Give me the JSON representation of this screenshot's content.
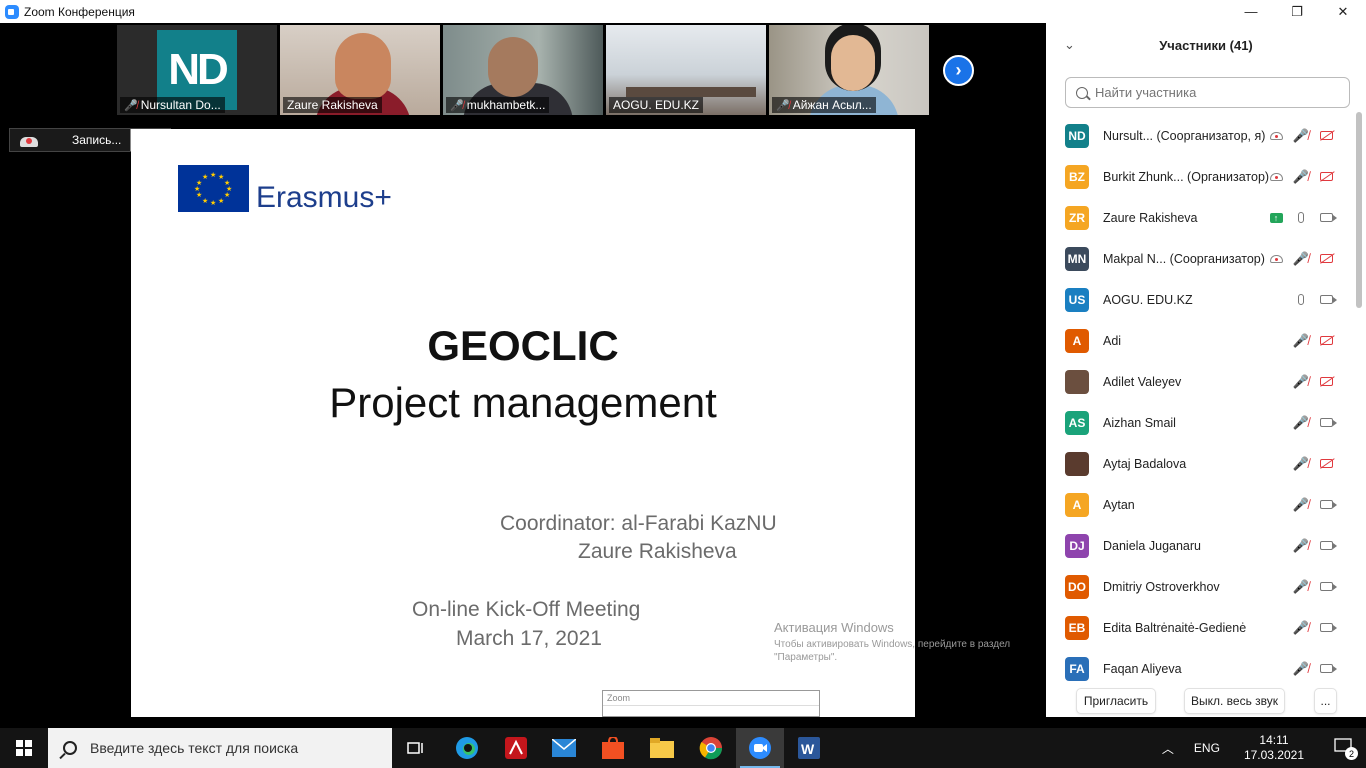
{
  "window": {
    "title": "Zoom Конференция",
    "minimize": "—",
    "maximize": "❐",
    "close": "✕"
  },
  "thumbnails": [
    {
      "name": "Nursultan Do...",
      "muted": true
    },
    {
      "name": "Zaure Rakisheva",
      "muted": false,
      "active": true
    },
    {
      "name": "mukhambetk...",
      "muted": true
    },
    {
      "name": "AOGU. EDU.KZ",
      "muted": false
    },
    {
      "name": "Айжан Асыл...",
      "muted": true
    }
  ],
  "thumb_logo": "ND",
  "recording": {
    "label": "Запись..."
  },
  "slide": {
    "brand": "Erasmus+",
    "title": "GEOCLIC",
    "subtitle": "Project management",
    "coordinator_line1": "Coordinator: al-Farabi KazNU",
    "coordinator_line2": "Zaure Rakisheva",
    "meeting_line1": "On-line Kick-Off Meeting",
    "meeting_line2": "March 17, 2021"
  },
  "activation": {
    "line1": "Активация Windows",
    "line2": "Чтобы активировать Windows, перейдите в раздел",
    "line3": "\"Параметры\"."
  },
  "zoom_popup": {
    "title": "Zoom"
  },
  "panel": {
    "collapse_icon": "⌄",
    "title": "Участники (41)",
    "search_placeholder": "Найти участника",
    "participants": [
      {
        "initials": "ND",
        "color": "#12808a",
        "name": "Nursult...  (Соорганизатор, я)",
        "rec": true,
        "mic": "off",
        "cam": "off"
      },
      {
        "initials": "BZ",
        "color": "#f5a623",
        "name": "Burkit Zhunk...  (Организатор)",
        "rec": true,
        "mic": "off",
        "cam": "off"
      },
      {
        "initials": "ZR",
        "color": "#f5a623",
        "name": "Zaure Rakisheva",
        "share": true,
        "mic": "on",
        "cam": "on"
      },
      {
        "initials": "MN",
        "color": "#3b4a5c",
        "name": "Makpal N...  (Соорганизатор)",
        "rec": true,
        "mic": "off",
        "cam": "off"
      },
      {
        "initials": "US",
        "color": "#1a7fc1",
        "name": "AOGU. EDU.KZ",
        "mic": "on",
        "cam": "on"
      },
      {
        "initials": "A",
        "color": "#e05a00",
        "name": "Adi",
        "mic": "off",
        "cam": "off"
      },
      {
        "initials": "",
        "color": "#6b4f3f",
        "name": "Adilet Valeyev",
        "photo": true,
        "mic": "off",
        "cam": "off"
      },
      {
        "initials": "AS",
        "color": "#1aa37a",
        "name": "Aizhan Smail",
        "mic": "off",
        "cam": "on"
      },
      {
        "initials": "",
        "color": "#5a3b2e",
        "name": "Aytaj Badalova",
        "photo": true,
        "mic": "off",
        "cam": "off"
      },
      {
        "initials": "A",
        "color": "#f5a623",
        "name": "Aytan",
        "mic": "off",
        "cam": "on"
      },
      {
        "initials": "DJ",
        "color": "#8e44ad",
        "name": "Daniela Juganaru",
        "mic": "off",
        "cam": "on"
      },
      {
        "initials": "DO",
        "color": "#e05a00",
        "name": "Dmitriy Ostroverkhov",
        "mic": "off",
        "cam": "on"
      },
      {
        "initials": "EB",
        "color": "#e05a00",
        "name": "Edita Baltrėnaitė-Gedienė",
        "mic": "off",
        "cam": "on"
      },
      {
        "initials": "FA",
        "color": "#2a6fb8",
        "name": "Faqan Aliyeva",
        "mic": "off",
        "cam": "on"
      }
    ],
    "footer": {
      "invite": "Пригласить",
      "mute_all": "Выкл. весь звук",
      "more": "..."
    }
  },
  "taskbar": {
    "search_placeholder": "Введите здесь текст для поиска",
    "lang": "ENG",
    "time": "14:11",
    "date": "17.03.2021",
    "notifications": "2",
    "apps": [
      "task-view",
      "edge",
      "acrobat",
      "mail",
      "store",
      "explorer",
      "chrome",
      "zoom",
      "word"
    ]
  }
}
